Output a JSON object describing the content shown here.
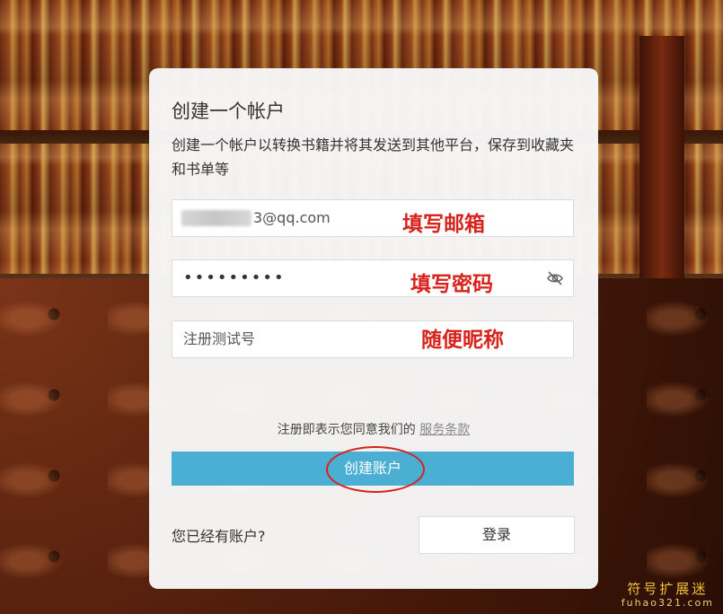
{
  "dialog": {
    "title": "创建一个帐户",
    "subtitle": "创建一个帐户以转换书籍并将其发送到其他平台，保存到收藏夹和书单等",
    "email": {
      "value": "3@qq.com",
      "annotation": "填写邮箱"
    },
    "password": {
      "value": "•••••••••",
      "annotation": "填写密码",
      "toggle_icon": "eye-off-icon"
    },
    "nickname": {
      "value": "注册测试号",
      "annotation": "随便昵称"
    },
    "terms": {
      "text": "注册即表示您同意我们的",
      "link": "服务条款"
    },
    "create_button": "创建账户",
    "have_account": "您已经有账户?",
    "login_button": "登录"
  },
  "watermark": {
    "name": "符号扩展迷",
    "url": "fuhao321.com"
  },
  "colors": {
    "accent": "#4aafd2",
    "annotation": "#d8231c"
  }
}
